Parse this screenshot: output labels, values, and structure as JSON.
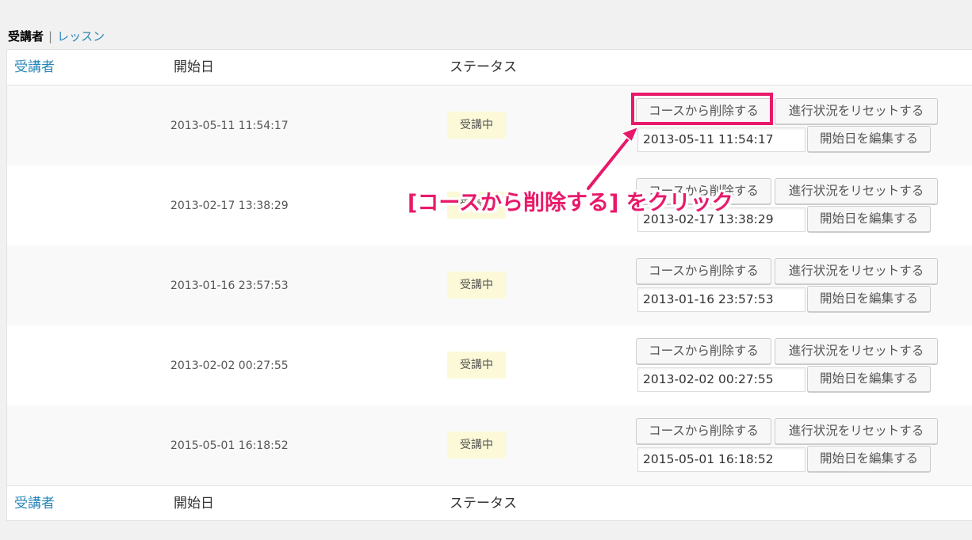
{
  "subnav": {
    "current": "受講者",
    "separator": "|",
    "link": "レッスン"
  },
  "columns": {
    "learner": "受講者",
    "start_date": "開始日",
    "status": "ステータス"
  },
  "rows": [
    {
      "date": "2013-05-11 11:54:17",
      "status": "受講中",
      "remove_label": "コースから削除する",
      "reset_label": "進行状況をリセットする",
      "input_value": "2013-05-11 11:54:17",
      "edit_label": "開始日を編集する"
    },
    {
      "date": "2013-02-17 13:38:29",
      "status": "受講中",
      "remove_label": "コースから削除する",
      "reset_label": "進行状況をリセットする",
      "input_value": "2013-02-17 13:38:29",
      "edit_label": "開始日を編集する"
    },
    {
      "date": "2013-01-16 23:57:53",
      "status": "受講中",
      "remove_label": "コースから削除する",
      "reset_label": "進行状況をリセットする",
      "input_value": "2013-01-16 23:57:53",
      "edit_label": "開始日を編集する"
    },
    {
      "date": "2013-02-02 00:27:55",
      "status": "受講中",
      "remove_label": "コースから削除する",
      "reset_label": "進行状況をリセットする",
      "input_value": "2013-02-02 00:27:55",
      "edit_label": "開始日を編集する"
    },
    {
      "date": "2015-05-01 16:18:52",
      "status": "受講中",
      "remove_label": "コースから削除する",
      "reset_label": "進行状況をリセットする",
      "input_value": "2015-05-01 16:18:52",
      "edit_label": "開始日を編集する"
    }
  ],
  "annotation": {
    "text": "[コースから削除する] をクリック",
    "color": "#e8196a"
  },
  "colors": {
    "link": "#2a86b8",
    "status_badge_bg": "#fcf9d8",
    "highlight": "#e8196a"
  }
}
